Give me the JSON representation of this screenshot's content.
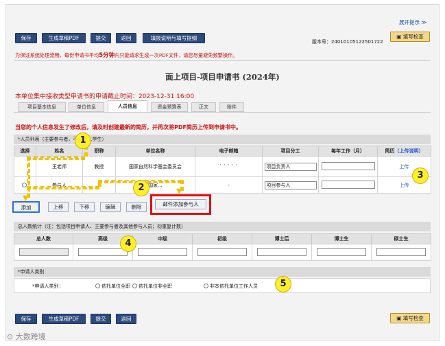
{
  "expand_hint": "展开提示 ≫",
  "toolbar": {
    "save": "保存",
    "generate_pdf": "生成草稿PDF",
    "submit": "提交",
    "back": "返回",
    "fill_guide": "填报说明与填写提纲",
    "check": "填写检查"
  },
  "version_label": "版本号：24010105122501722",
  "notice": {
    "prefix": "为保证系统处理流畅，每份申请书平均",
    "minutes": "5分钟",
    "suffix": "内只能请求生成一次PDF文件，请您尽量避免频繁操作。"
  },
  "page_title": "面上项目-项目申请书 (2024年)",
  "deadline": "本单位集中接收类型申请书的申请截止时间：2023-12-31 16:00",
  "tabs": [
    "项目基本信息",
    "单位信息",
    "人员信息",
    "资金预算表",
    "正文",
    "附件"
  ],
  "warning": "当您的个人信息发生了修改后，请及时创建最新的简历，并再次将PDF简历上传到申请书中。",
  "personnel": {
    "heading": "*人员列表（主要参与者，不再列入学生）",
    "columns": [
      "选择",
      "姓名",
      "职称",
      "单位名称",
      "电子邮箱"
    ],
    "rows": [
      {
        "name": "王老师",
        "title": "教授",
        "unit": "国家自然科学基金委员会",
        "email": "` ` ` ` `",
        "selected": false
      },
      {
        "name": "参与人",
        "title": "",
        "unit": "国家...",
        "email": "-",
        "selected": false
      }
    ]
  },
  "division": {
    "columns": [
      "项目分工",
      "每年工作（月）",
      "简历",
      "（上传说明）"
    ],
    "rows": [
      {
        "role": "项目负责人",
        "months": "",
        "cv": "上传"
      },
      {
        "role": "项目参与人",
        "months": "",
        "cv": "上传"
      }
    ]
  },
  "actions": {
    "add": "添加",
    "up": "上移",
    "down": "下移",
    "edit": "编辑",
    "delete": "删除",
    "email_add": "邮件添加参与人"
  },
  "stats": {
    "heading": "总人数统计（注：包括项目申请人、主要参与者及其他参与人员；勿重复计数）",
    "columns": [
      "总人数",
      "高级",
      "中级",
      "初级",
      "博士后",
      "博士生",
      "硕士生"
    ]
  },
  "category": {
    "heading": "*申请人类别",
    "label": "*申请人类别：",
    "options": [
      "依托单位全职",
      "依托单位非全职",
      "非本依托单位工作人员"
    ]
  },
  "badges": [
    "1",
    "2",
    "3",
    "4",
    "5"
  ],
  "watermark": "大数跨境",
  "colors": {
    "navy": "#2d4a7c",
    "accent_red": "#cc1111",
    "badge_yellow": "#ffee2e"
  }
}
